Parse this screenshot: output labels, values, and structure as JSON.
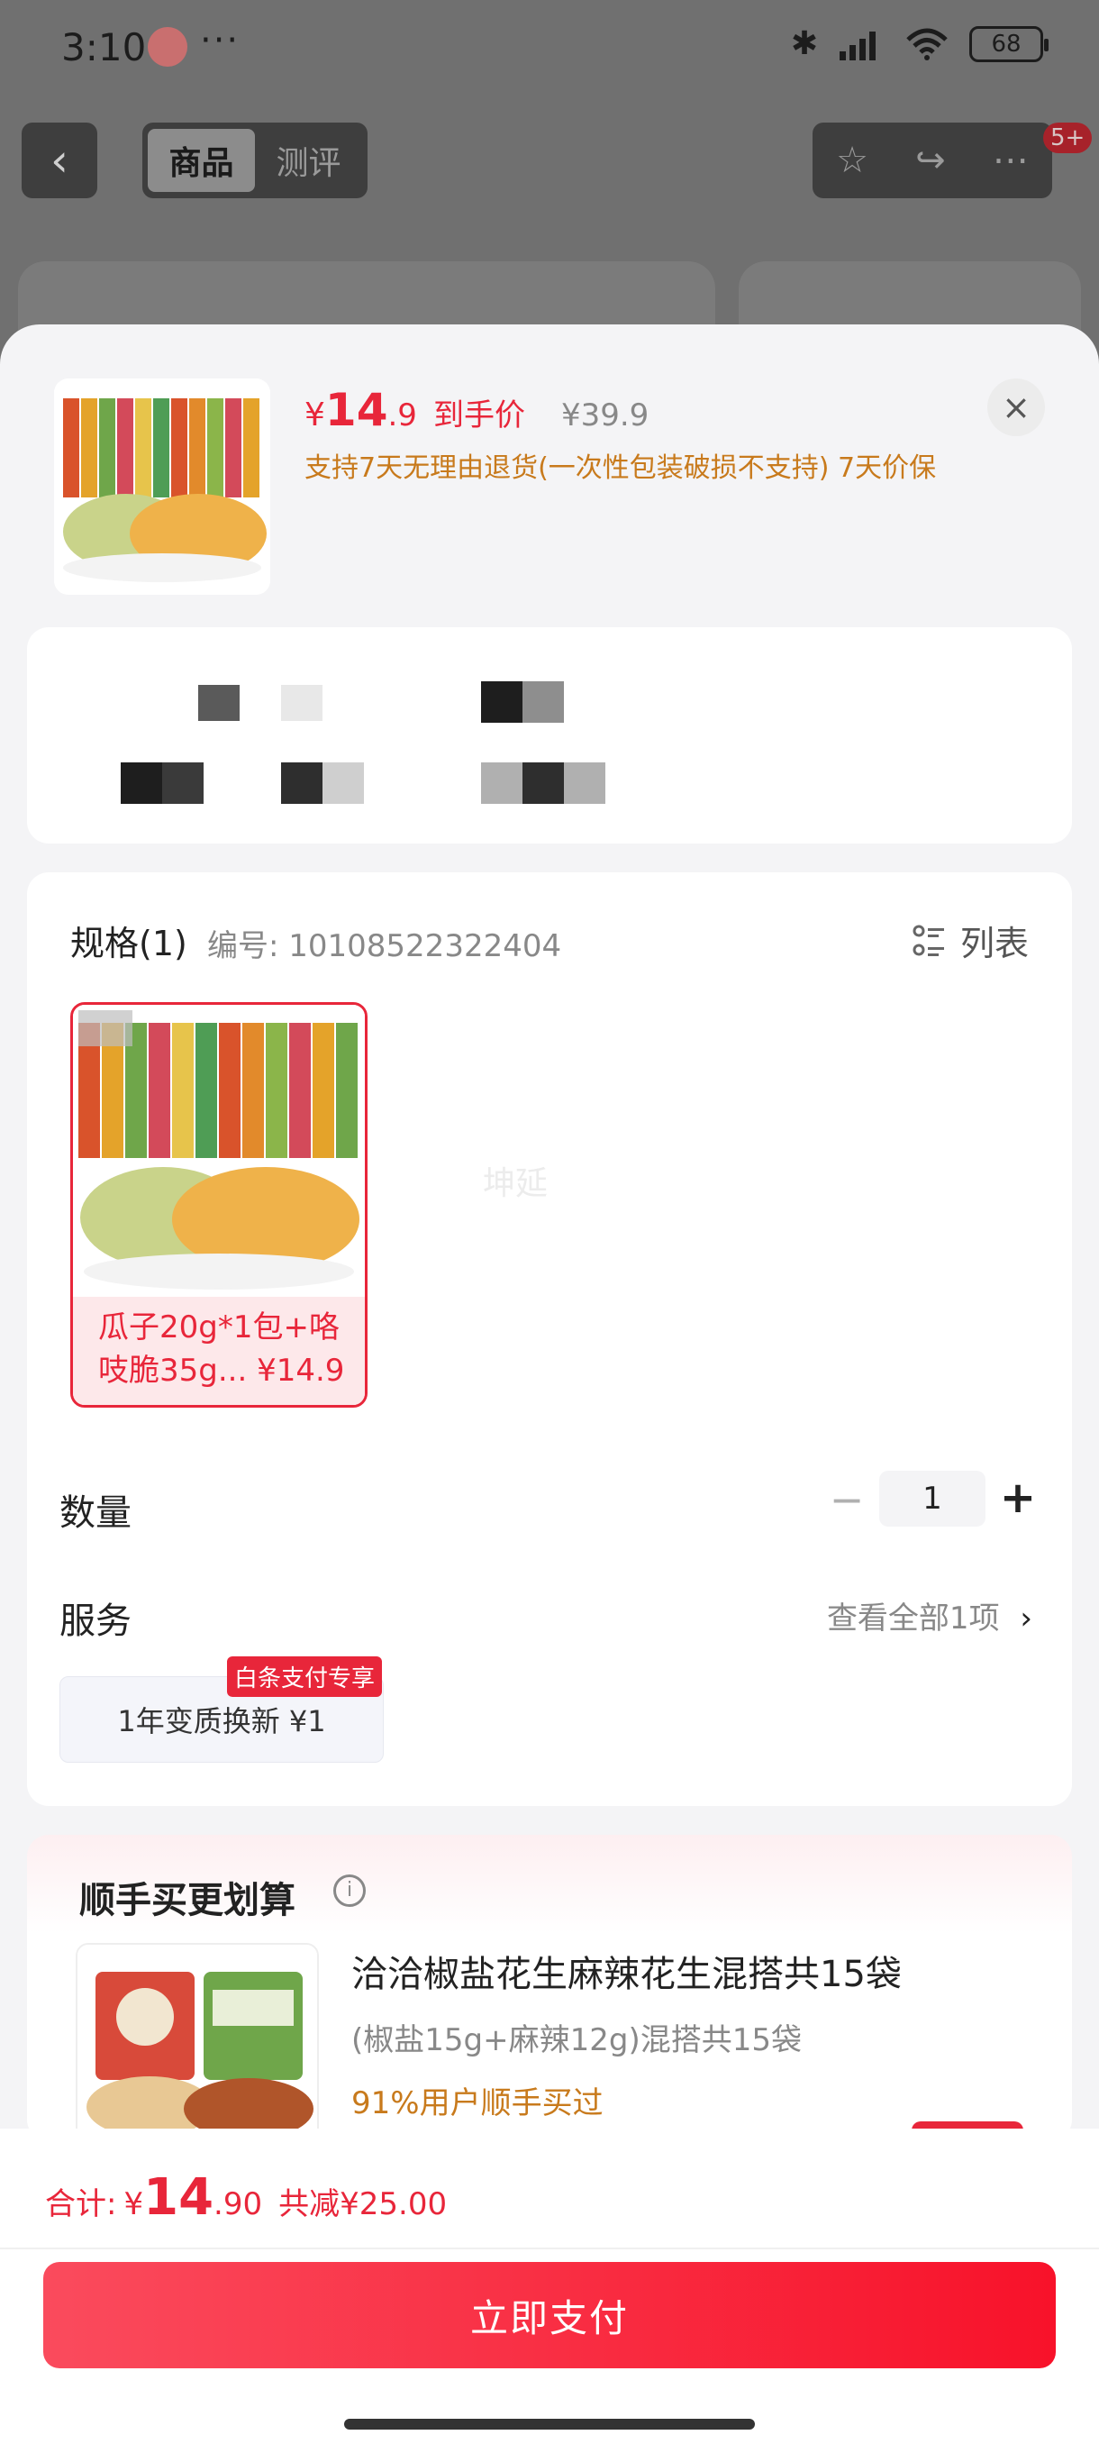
{
  "status_bar": {
    "time": "3:10",
    "more": "···",
    "battery": "68"
  },
  "nav": {
    "tabs": [
      {
        "label": "商品",
        "active": true
      },
      {
        "label": "测评",
        "active": false
      }
    ],
    "badge": "5+"
  },
  "product": {
    "price_symbol": "¥",
    "price_int": "14",
    "price_dec": ".9",
    "price_label": "到手价",
    "original_price": "¥39.9",
    "promise": "支持7天无理由退货(一次性包装破损不支持) 7天价保"
  },
  "spec": {
    "title": "规格(1)",
    "code": "编号: 10108522322404",
    "list_view_label": "列表",
    "options": [
      {
        "label": "瓜子20g*1包+咯吱脆35g...  ¥14.9",
        "selected": true
      }
    ],
    "watermark": "坤延"
  },
  "quantity": {
    "label": "数量",
    "minus": "−",
    "value": "1",
    "plus": "+"
  },
  "service": {
    "label": "服务",
    "view_all": "查看全部1项",
    "chip": "1年变质换新  ¥1",
    "tag": "白条支付专享"
  },
  "bundle": {
    "title": "顺手买更划算",
    "name": "洽洽椒盐花生麻辣花生混搭共15袋",
    "desc": "(椒盐15g+麻辣12g)混搭共15袋",
    "stat": "91%用户顺手买过"
  },
  "footer": {
    "total_label": "合计:",
    "total_symbol": "¥",
    "total_int": "14",
    "total_dec": ".90",
    "saved": "共减¥25.00",
    "pay_button": "立即支付"
  },
  "colors": {
    "accent": "#e8263a",
    "promise": "#c87a1c",
    "sheet_bg": "#f4f4f6"
  }
}
